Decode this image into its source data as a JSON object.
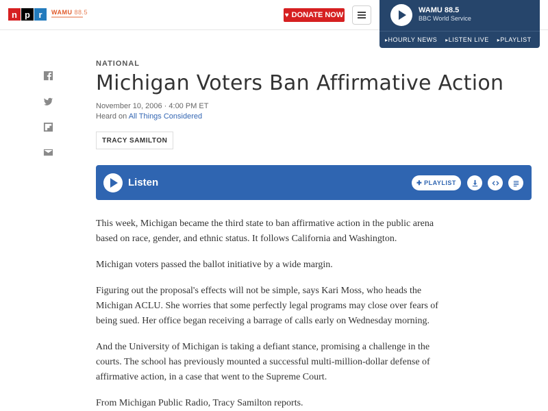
{
  "header": {
    "logo_letters": [
      "n",
      "p",
      "r"
    ],
    "station_logo": "WAMU",
    "station_freq": "88.5",
    "donate_label": "DONATE NOW",
    "menu_icon": "hamburger-icon",
    "colors": {
      "npr_red": "#d62021",
      "npr_blue": "#237bbd",
      "donate": "#d62021"
    }
  },
  "player": {
    "station": "WAMU 88.5",
    "program": "BBC World Service",
    "links": [
      "HOURLY NEWS",
      "LISTEN LIVE",
      "PLAYLIST"
    ],
    "background": "#26456b"
  },
  "share": {
    "icons": [
      "facebook-icon",
      "twitter-icon",
      "flipboard-icon",
      "email-icon"
    ]
  },
  "article": {
    "slug": "NATIONAL",
    "headline": "Michigan Voters Ban Affirmative Action",
    "dateline": "November 10, 2006 · 4:00 PM ET",
    "heard_prefix": "Heard on ",
    "heard_program": "All Things Considered",
    "byline": "TRACY SAMILTON",
    "listen": {
      "label": "Listen",
      "playlist_label": "PLAYLIST",
      "background": "#2f65b1",
      "actions": [
        "download-icon",
        "embed-icon",
        "transcript-icon"
      ]
    },
    "paragraphs": [
      "This week, Michigan became the third state to ban affirmative action in the public arena based on race, gender, and ethnic status. It follows California and Washington.",
      "Michigan voters passed the ballot initiative by a wide margin.",
      "Figuring out the proposal's effects will not be simple, says Kari Moss, who heads the Michigan ACLU. She worries that some perfectly legal programs may close over fears of being sued. Her office began receiving a barrage of calls early on Wednesday morning.",
      "And the University of Michigan is taking a defiant stance, promising a challenge in the courts. The school has previously mounted a successful multi-million-dollar defense of affirmative action, in a case that went to the Supreme Court.",
      "From Michigan Public Radio, Tracy Samilton reports."
    ]
  }
}
